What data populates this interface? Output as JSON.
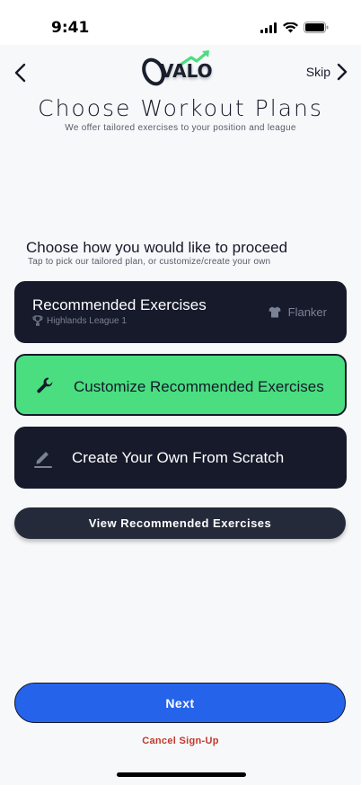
{
  "status": {
    "time": "9:41"
  },
  "nav": {
    "skip_label": "Skip",
    "logo_text": "VALO"
  },
  "header": {
    "title": "Choose Workout Plans",
    "subtitle": "We offer tailored exercises to your position and league"
  },
  "proceed": {
    "title": "Choose how you would like to proceed",
    "subtitle": "Tap to pick our tailored plan, or customize/create your own"
  },
  "options": {
    "recommended": {
      "title": "Recommended Exercises",
      "league": "Highlands League 1",
      "position": "Flanker"
    },
    "customize": {
      "label": "Customize Recommended Exercises"
    },
    "scratch": {
      "label": "Create Your Own From Scratch"
    }
  },
  "actions": {
    "view_label": "View Recommended Exercises",
    "next_label": "Next",
    "cancel_label": "Cancel Sign-Up"
  },
  "colors": {
    "dark_card": "#161a2b",
    "selected_green": "#4ade80",
    "primary_blue": "#2563eb",
    "cancel_red": "#c0392b"
  }
}
